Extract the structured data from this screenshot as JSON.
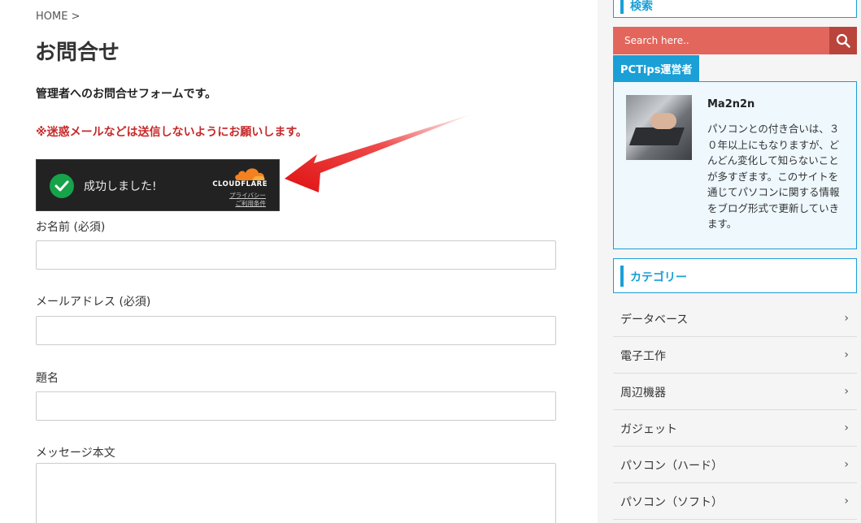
{
  "breadcrumb": {
    "home": "HOME",
    "separator": ">"
  },
  "page_title": "お問合せ",
  "intro_text": "管理者へのお問合せフォームです。",
  "warning_text": "※迷惑メールなどは送信しないようにお願いします。",
  "turnstile": {
    "status": "成功しました!",
    "brand": "CLOUDFLARE",
    "privacy_link": "プライバシー",
    "terms_link": "ご利用条件"
  },
  "form": {
    "name_label": "お名前 (必須)",
    "name_value": "",
    "email_label": "メールアドレス (必須)",
    "email_value": "",
    "subject_label": "題名",
    "subject_value": "",
    "message_label": "メッセージ本文",
    "message_value": ""
  },
  "sidebar": {
    "search_heading": "検索",
    "search_placeholder": "Search here..",
    "author_tab": "PCTips運営者",
    "author_name": "Ma2n2n",
    "author_bio": "パソコンとの付き合いは、３０年以上にもなりますが、どんどん変化して知らないことが多すぎます。このサイトを通じてパソコンに関する情報をブログ形式で更新していきます。",
    "category_heading": "カテゴリー",
    "categories": [
      "データベース",
      "電子工作",
      "周辺機器",
      "ガジェット",
      "パソコン（ハード）",
      "パソコン（ソフト）"
    ]
  },
  "colors": {
    "accent": "#1a9fd6",
    "search_bg": "#e3665c",
    "warning": "#c62a2a",
    "arrow": "#e01010",
    "success": "#16a34a"
  }
}
